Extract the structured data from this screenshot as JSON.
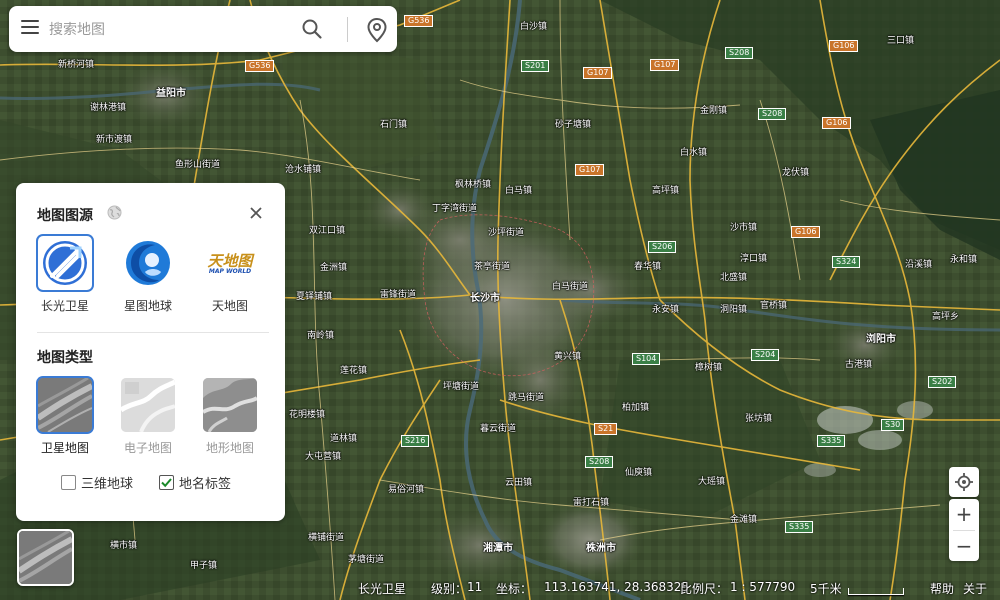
{
  "search": {
    "placeholder": "搜索地图"
  },
  "panel": {
    "source_title": "地图图源",
    "sources": [
      {
        "label": "长光卫星",
        "selected": true
      },
      {
        "label": "星图地球",
        "selected": false
      },
      {
        "label": "天地图",
        "selected": false,
        "logo_text": "天地图",
        "logo_sub": "MAP WORLD"
      }
    ],
    "type_title": "地图类型",
    "types": [
      {
        "label": "卫星地图",
        "selected": true
      },
      {
        "label": "电子地图",
        "selected": false
      },
      {
        "label": "地形地图",
        "selected": false
      }
    ],
    "options": [
      {
        "label": "三维地球",
        "checked": false
      },
      {
        "label": "地名标签",
        "checked": true
      }
    ]
  },
  "status": {
    "source": "长光卫星",
    "level_label": "级别：",
    "level": "11",
    "coord_label": "坐标：",
    "coords": "113.163741, 28.368325",
    "scale_label": "比例尺：",
    "scale": "1 : 577790",
    "scalebar_label": "5千米",
    "help": "帮助",
    "about": "关于"
  },
  "map": {
    "places": [
      "新桥河镇",
      "益阳市",
      "谢林港镇",
      "新市渡镇",
      "鱼形山街道",
      "沧水铺镇",
      "双江口镇",
      "金洲镇",
      "夏铎铺镇",
      "南岭镇",
      "莲花镇",
      "花明楼镇",
      "道林镇",
      "大屯营镇",
      "横市镇",
      "甲子镇",
      "横铺街道",
      "茅塘街道",
      "易俗河镇",
      "石门镇",
      "白沙镇",
      "枫林桥镇",
      "白马镇",
      "砂子塘镇",
      "丁字湾街道",
      "沙坪街道",
      "茶亭街道",
      "白马街道",
      "长沙市",
      "雷锋街道",
      "坪塘街道",
      "跳马街道",
      "暮云街道",
      "湘潭市",
      "株洲市",
      "云田镇",
      "雷打石镇",
      "洞阳镇",
      "北盛镇",
      "黄兴镇",
      "永安镇",
      "春华镇",
      "沙市镇",
      "浏阳市",
      "官桥镇",
      "金刚镇",
      "白水镇",
      "高坪镇",
      "古港镇",
      "永和镇",
      "淳口镇",
      "沿溪镇",
      "高坪乡",
      "樟树镇",
      "柏加镇",
      "仙庾镇",
      "龙伏镇",
      "张坊镇",
      "大瑶镇",
      "金滩镇",
      "三口镇"
    ]
  }
}
